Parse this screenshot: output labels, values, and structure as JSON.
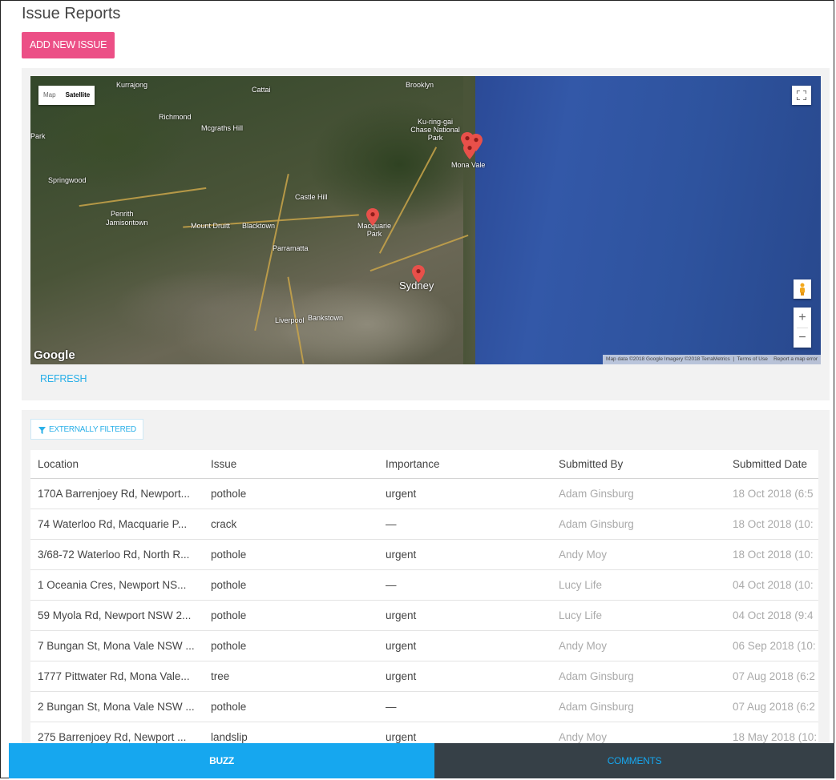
{
  "page": {
    "title": "Issue Reports",
    "add_button": "ADD NEW ISSUE"
  },
  "map": {
    "type_control": {
      "map": "Map",
      "satellite": "Satellite",
      "selected": "Satellite"
    },
    "labels": {
      "kurrajong": "Kurrajong",
      "cattai": "Cattai",
      "brooklyn": "Brooklyn",
      "richmond": "Richmond",
      "mcgraths_hill": "Mcgraths Hill",
      "park": "Park",
      "kuringgai": "Ku-ring-gai Chase National Park",
      "mona_vale": "Mona Vale",
      "springwood": "Springwood",
      "castle_hill": "Castle Hill",
      "penrith": "Penrith",
      "jamisontown": "Jamisontown",
      "mount_druitt": "Mount Druitt",
      "blacktown": "Blacktown",
      "macquarie_park": "Macquarie Park",
      "parramatta": "Parramatta",
      "sydney": "Sydney",
      "liverpool": "Liverpool",
      "bankstown": "Bankstown"
    },
    "google": "Google",
    "attribution": "Map data ©2018 Google Imagery ©2018 TerraMetrics",
    "terms": "Terms of Use",
    "report": "Report a map error",
    "zoom_in": "+",
    "zoom_out": "−"
  },
  "refresh_label": "REFRESH",
  "filter_label": "EXTERNALLY FILTERED",
  "table": {
    "headers": [
      "Location",
      "Issue",
      "Importance",
      "Submitted By",
      "Submitted Date"
    ],
    "rows": [
      {
        "location": "170A Barrenjoey Rd, Newport...",
        "issue": "pothole",
        "importance": "urgent",
        "by": "Adam Ginsburg",
        "date": "18 Oct 2018 (6:5"
      },
      {
        "location": "74 Waterloo Rd, Macquarie P...",
        "issue": "crack",
        "importance": "—",
        "by": "Adam Ginsburg",
        "date": "18 Oct 2018 (10:"
      },
      {
        "location": "3/68-72 Waterloo Rd, North R...",
        "issue": "pothole",
        "importance": "urgent",
        "by": "Andy Moy",
        "date": "18 Oct 2018 (10:"
      },
      {
        "location": "1 Oceania Cres, Newport NS...",
        "issue": "pothole",
        "importance": "—",
        "by": "Lucy Life",
        "date": "04 Oct 2018 (10:"
      },
      {
        "location": "59 Myola Rd, Newport NSW 2...",
        "issue": "pothole",
        "importance": "urgent",
        "by": "Lucy Life",
        "date": "04 Oct 2018 (9:4"
      },
      {
        "location": "7 Bungan St, Mona Vale NSW ...",
        "issue": "pothole",
        "importance": "urgent",
        "by": "Andy Moy",
        "date": "06 Sep 2018 (10:"
      },
      {
        "location": "1777 Pittwater Rd, Mona Vale...",
        "issue": "tree",
        "importance": "urgent",
        "by": "Adam Ginsburg",
        "date": "07 Aug 2018 (6:2"
      },
      {
        "location": "2 Bungan St, Mona Vale NSW ...",
        "issue": "pothole",
        "importance": "—",
        "by": "Adam Ginsburg",
        "date": "07 Aug 2018 (6:2"
      },
      {
        "location": "275 Barrenjoey Rd, Newport ...",
        "issue": "landslip",
        "importance": "urgent",
        "by": "Andy Moy",
        "date": "18 May 2018 (10:"
      }
    ]
  },
  "nav": {
    "buzz": "BUZZ",
    "comments": "COMMENTS"
  },
  "colors": {
    "accent_pink": "#ec4f86",
    "accent_blue": "#16a7ef",
    "dark_nav": "#364047"
  }
}
